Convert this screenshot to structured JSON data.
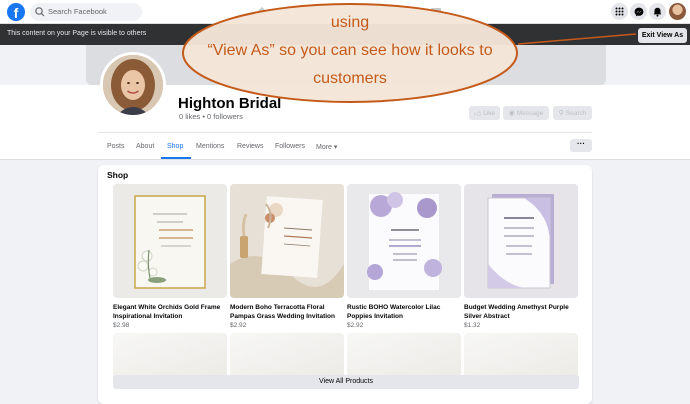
{
  "topbar": {
    "logo": "f",
    "search_placeholder": "Search Facebook",
    "icons": [
      "menu-grid-icon",
      "messenger-icon",
      "bell-icon",
      "account-avatar"
    ]
  },
  "banner": {
    "text": "This content on your Page is visible to others",
    "exit_label": "Exit View As"
  },
  "annotation": {
    "lines": [
      "using",
      "“View As” so you can see how it looks to",
      "customers"
    ],
    "color": "#c45a1a"
  },
  "profile": {
    "name": "Highton Bridal",
    "meta": "0 likes • 0 followers",
    "actions": [
      {
        "label": "Like",
        "icon": "thumbs-up-icon"
      },
      {
        "label": "Message",
        "icon": "messenger-icon"
      },
      {
        "label": "Search",
        "icon": "search-icon"
      }
    ]
  },
  "tabs": [
    {
      "label": "Posts",
      "active": false
    },
    {
      "label": "About",
      "active": false
    },
    {
      "label": "Shop",
      "active": true
    },
    {
      "label": "Mentions",
      "active": false
    },
    {
      "label": "Reviews",
      "active": false
    },
    {
      "label": "Followers",
      "active": false
    },
    {
      "label": "More ▾",
      "active": false
    }
  ],
  "more_button": "···",
  "shop": {
    "title": "Shop",
    "products": [
      {
        "name": "Elegant White Orchids Gold Frame Inspirational Invitation",
        "price": "$2.98"
      },
      {
        "name": "Modern Boho Terracotta Floral Pampas Grass Wedding Invitation",
        "price": "$2.92"
      },
      {
        "name": "Rustic BOHO Watercolor Lilac Poppies Invitation",
        "price": "$2.92"
      },
      {
        "name": "Budget Wedding Amethyst Purple Silver Abstract",
        "price": "$1.32"
      }
    ],
    "view_all_label": "View All Products"
  },
  "colors": {
    "brand": "#1877f2",
    "banner": "#2f3133",
    "annotation": "#c45a1a"
  }
}
